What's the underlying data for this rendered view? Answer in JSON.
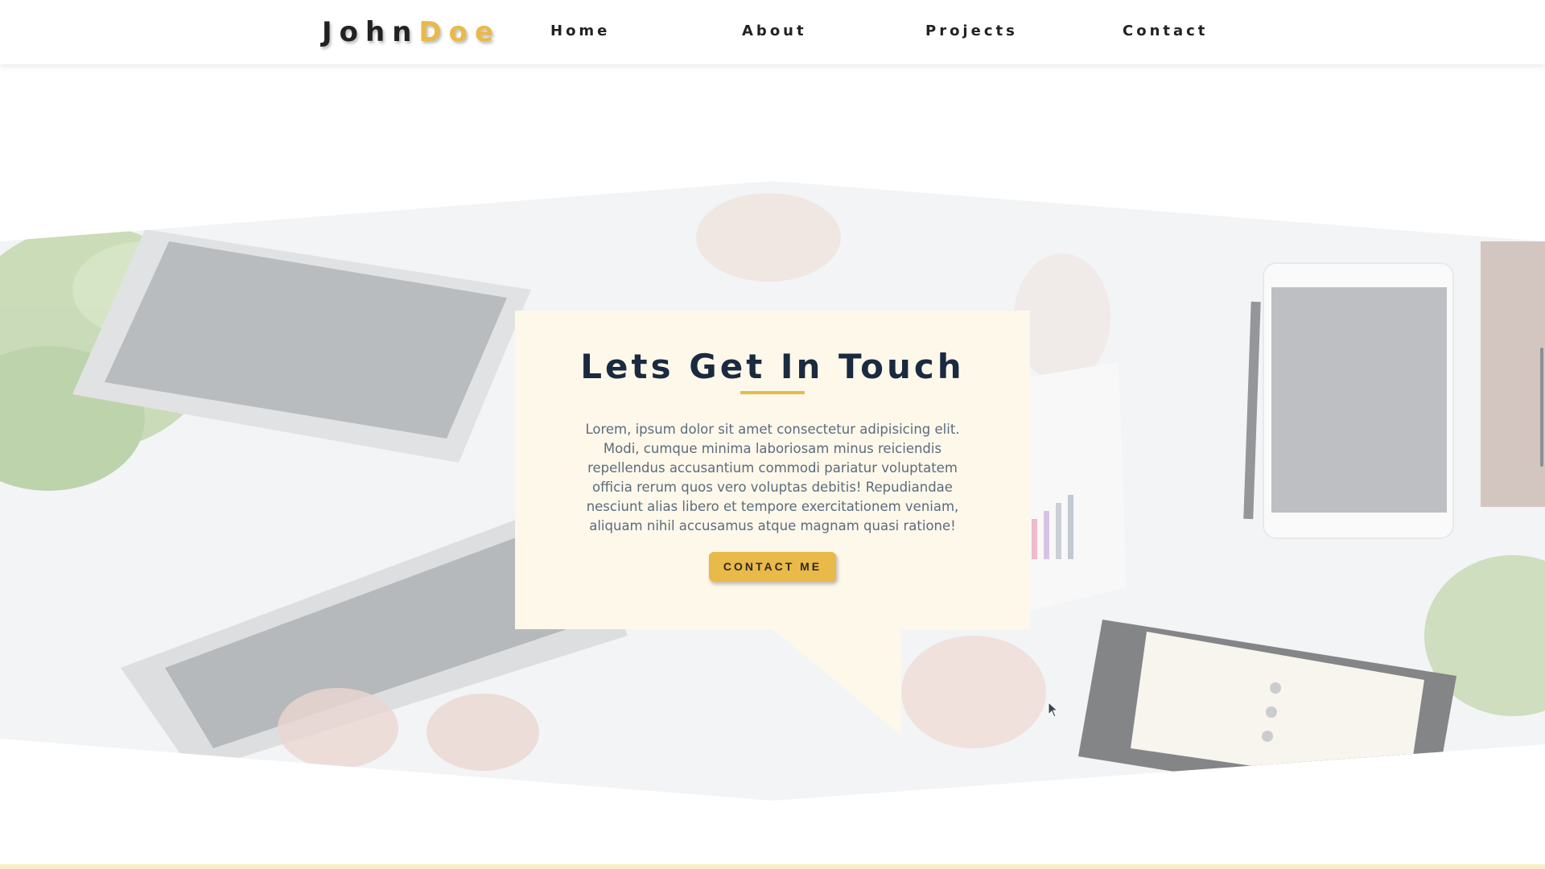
{
  "navbar": {
    "logo_first": "John",
    "logo_last": "Doe",
    "links": [
      "Home",
      "About",
      "Projects",
      "Contact"
    ]
  },
  "contact_card": {
    "title": "Lets Get In Touch",
    "body": "Lorem, ipsum dolor sit amet consectetur adipisicing elit. Modi, cumque minima laboriosam minus reiciendis repellendus accusantium commodi pariatur voluptatem officia rerum quos vero voluptas debitis! Repudiandae nesciunt alias libero et tempore exercitationem veniam, aliquam nihil accusamus atque magnam quasi ratione!",
    "button_label": "CONTACT ME"
  },
  "colors": {
    "accent": "#e9b949",
    "title": "#1a2a3f",
    "card_bg": "#fdf8ea",
    "text": "#5b6b7d"
  },
  "icons": {
    "cursor": "mouse-pointer-icon"
  }
}
